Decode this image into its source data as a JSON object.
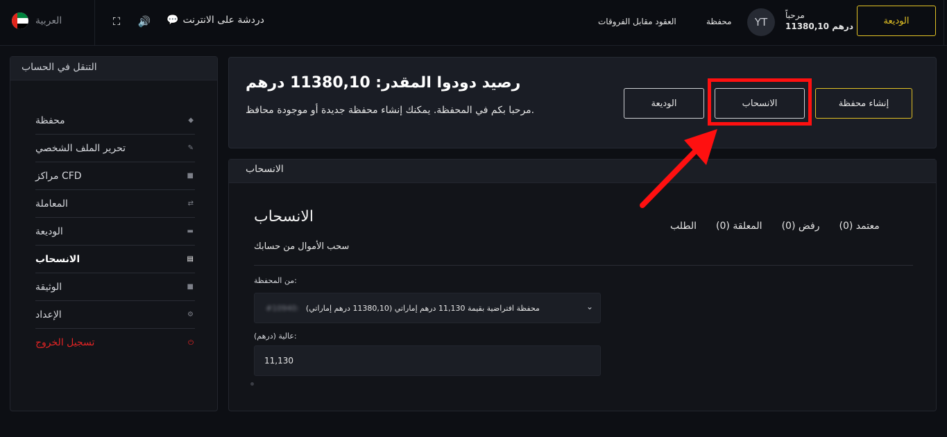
{
  "topbar": {
    "language": "العربية",
    "chat_label": "دردشة على الانترنت",
    "link_cfd": "العقود مقابل الفروقات",
    "link_wallet": "محفظة",
    "avatar_initials": "YT",
    "greeting": "مرحباً",
    "balance": "11380,10 درهم",
    "deposit_button": "الوديعة"
  },
  "sidebar": {
    "title": "التنقل في الحساب",
    "items": [
      {
        "label": "محفظة",
        "icon": "layers-icon"
      },
      {
        "label": "تحرير الملف الشخصي",
        "icon": "pencil-icon"
      },
      {
        "label": "مراكز CFD",
        "icon": "briefcase-icon"
      },
      {
        "label": "المعاملة",
        "icon": "swap-arrows-icon"
      },
      {
        "label": "الوديعة",
        "icon": "card-icon"
      },
      {
        "label": "الانسحاب",
        "icon": "document-icon"
      },
      {
        "label": "الوثيقة",
        "icon": "briefcase-icon"
      },
      {
        "label": "الإعداد",
        "icon": "gear-icon"
      },
      {
        "label": "تسجيل الخروج",
        "icon": "power-icon"
      }
    ]
  },
  "balance_panel": {
    "title": "رصيد دودوا المقدر: 11380,10 درهم",
    "subtitle": "مرحبا بكم في المحفظة. يمكنك إنشاء محفظة جديدة أو موجودة محافظ.",
    "deposit_button": "الوديعة",
    "withdraw_button": "الانسحاب",
    "create_wallet_button": "إنشاء محفظة"
  },
  "withdraw_panel": {
    "header": "الانسحاب",
    "title": "الانسحاب",
    "subtitle": "سحب الأموال من حسابك",
    "tabs": [
      "الطلب",
      "المعلقة (0)",
      "رفض (0)",
      "معتمد (0)"
    ],
    "from_wallet_label": "من المحفظة:",
    "wallet_option_id": "#10940:",
    "wallet_option": "محفظة افتراضية بقيمة 11,130 درهم إماراتي (11380,10 درهم إماراتي)",
    "amount_label": "عالية (درهم):",
    "amount_value": "11,130"
  },
  "colors": {
    "accent_yellow": "#e4c325",
    "highlight_red": "#ff1010",
    "logout_red": "#e32424"
  }
}
